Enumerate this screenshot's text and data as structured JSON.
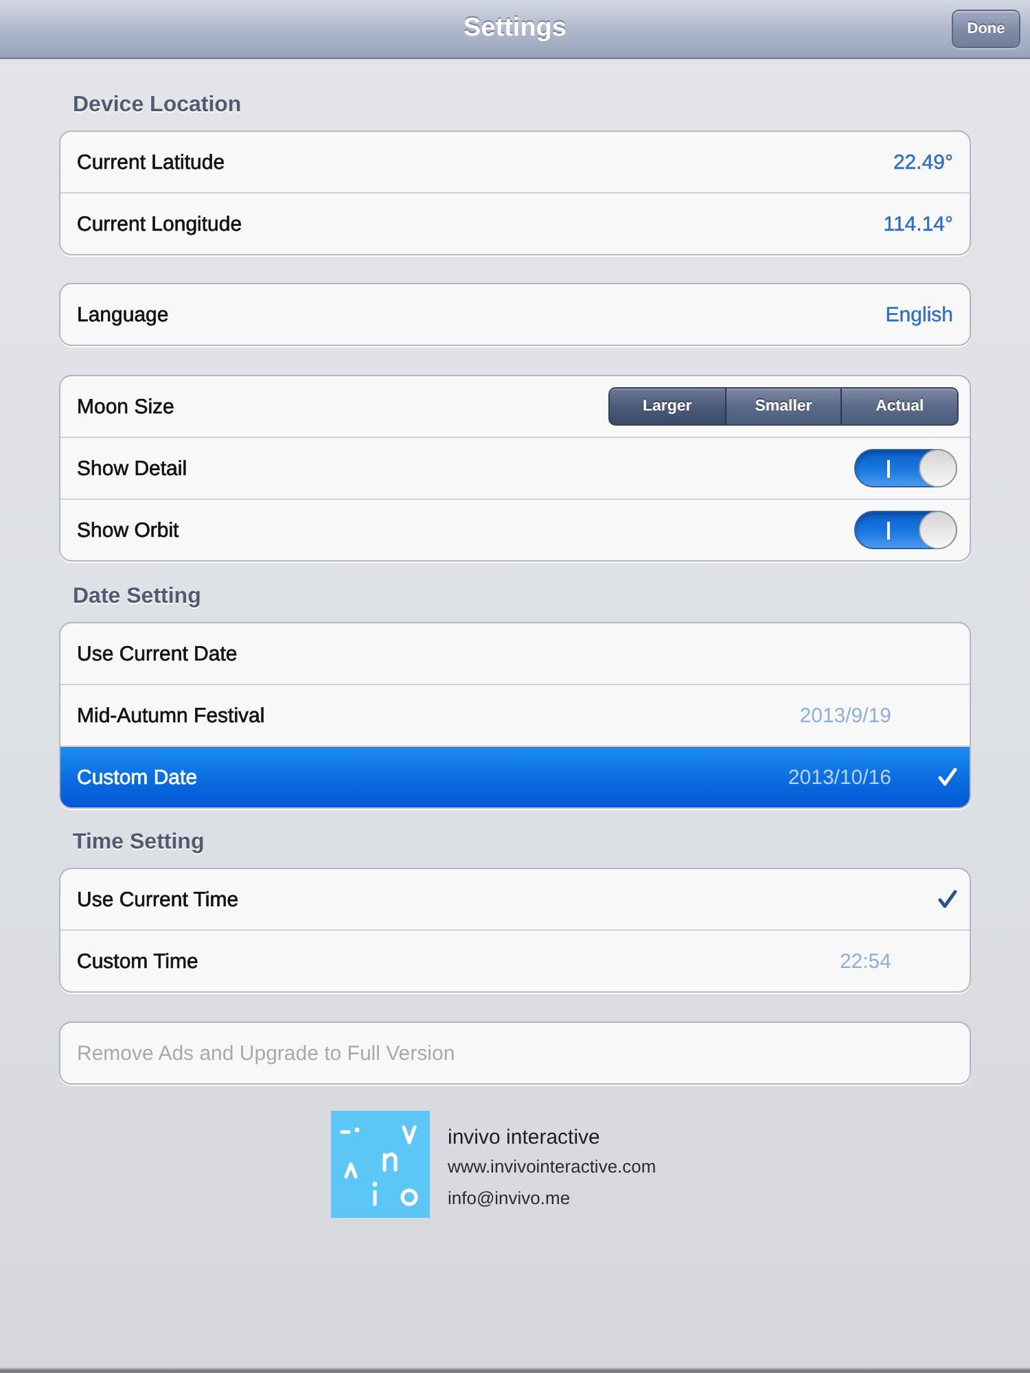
{
  "nav_bar": {
    "title": "Settings",
    "done_button": "Done"
  },
  "device_location": {
    "header": "Device Location",
    "rows": [
      {
        "label": "Current Latitude",
        "value": "22.49°"
      },
      {
        "label": "Current Longitude",
        "value": "114.14°"
      }
    ]
  },
  "language": {
    "label": "Language",
    "value": "English"
  },
  "display": {
    "moon_size": {
      "label": "Moon Size",
      "options": [
        {
          "label": "Larger",
          "selected": true
        },
        {
          "label": "Smaller",
          "selected": false
        },
        {
          "label": "Actual",
          "selected": false
        }
      ]
    },
    "toggles": [
      {
        "label": "Show Detail",
        "on": true
      },
      {
        "label": "Show Orbit",
        "on": true
      }
    ]
  },
  "date_setting": {
    "header": "Date Setting",
    "rows": [
      {
        "label": "Use Current Date",
        "selected": false,
        "checked": false
      },
      {
        "label": "Mid-Autumn Festival",
        "value": "2013/9/19",
        "selected": false,
        "checked": false
      },
      {
        "label": "Custom Date",
        "value": "2013/10/16",
        "selected": true,
        "checked": true
      }
    ]
  },
  "time_setting": {
    "header": "Time Setting",
    "rows": [
      {
        "label": "Use Current Time",
        "selected": false,
        "checked": true
      },
      {
        "label": "Custom Time",
        "value": "22:54",
        "selected": false,
        "checked": false
      }
    ]
  },
  "upgrade": {
    "label": "Remove Ads and Upgrade to Full Version"
  },
  "footer": {
    "company": "invivo interactive",
    "website": "www.invivointeractive.com",
    "email": "info@invivo.me"
  }
}
